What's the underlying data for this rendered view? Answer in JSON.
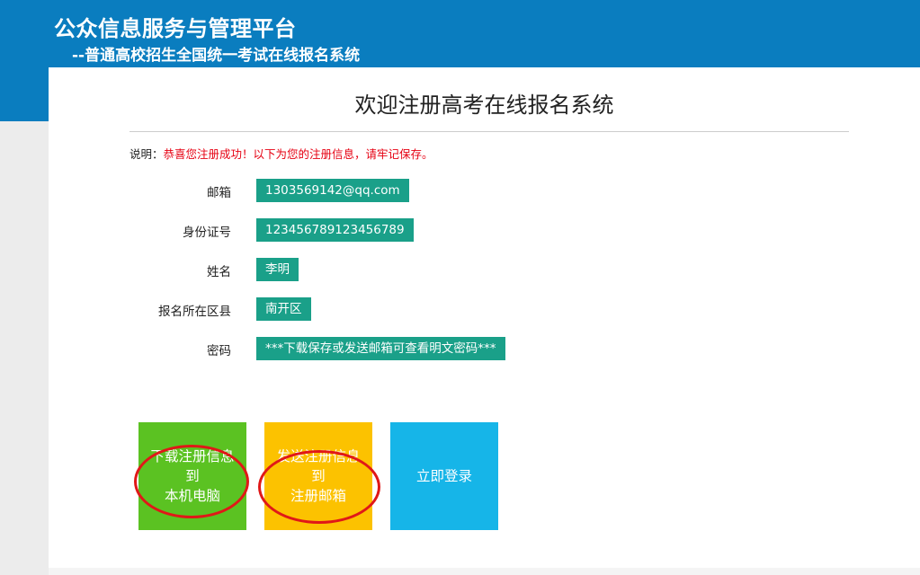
{
  "header": {
    "title": "公众信息服务与管理平台",
    "subtitle": "--普通高校招生全国统一考试在线报名系统"
  },
  "main": {
    "welcome_title": "欢迎注册高考在线报名系统",
    "note_prefix": "说明：",
    "note_message": "恭喜您注册成功！以下为您的注册信息，请牢记保存。",
    "fields": [
      {
        "label": "邮箱",
        "value": "1303569142@qq.com"
      },
      {
        "label": "身份证号",
        "value": "123456789123456789"
      },
      {
        "label": "姓名",
        "value": "李明"
      },
      {
        "label": "报名所在区县",
        "value": "南开区"
      },
      {
        "label": "密码",
        "value": "***下载保存或发送邮箱可查看明文密码***"
      }
    ],
    "buttons": {
      "download_line1": "下载注册信息到",
      "download_line2": "本机电脑",
      "send_line1": "发送注册信息到",
      "send_line2": "注册邮箱",
      "login": "立即登录"
    }
  },
  "colors": {
    "header_bg": "#0a7dbf",
    "value_bg": "#1aa089",
    "note_red": "#e60012",
    "tile_green": "#5bc222",
    "tile_yellow": "#fcc200",
    "tile_blue": "#16b5e8",
    "annotation_circle": "#e01818"
  }
}
